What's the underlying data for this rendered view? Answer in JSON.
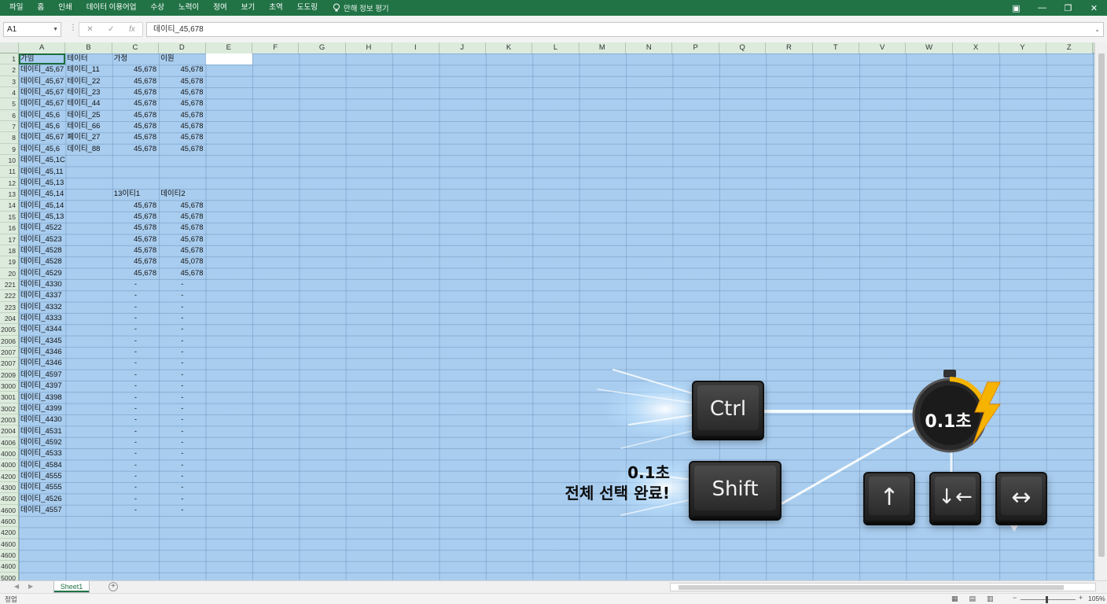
{
  "menu": {
    "items": [
      "파일",
      "홈",
      "인쇄",
      "데이터 이용어업",
      "수상",
      "노력이",
      "정여",
      "보기",
      "초역",
      "도도링"
    ],
    "tell_me": "만해 정보 평기"
  },
  "formula_bar": {
    "name_box": "A1",
    "formula": "데이티_45,678"
  },
  "columns": [
    "A",
    "B",
    "C",
    "D",
    "E",
    "F",
    "G",
    "H",
    "I",
    "J",
    "K",
    "L",
    "M",
    "N",
    "P",
    "Q",
    "R",
    "T",
    "V",
    "W",
    "X",
    "Y",
    "Z"
  ],
  "row_numbers": [
    "1",
    "2",
    "3",
    "4",
    "5",
    "6",
    "7",
    "8",
    "9",
    "10",
    "11",
    "12",
    "13",
    "14",
    "15",
    "16",
    "17",
    "18",
    "19",
    "20",
    "221",
    "222",
    "223",
    "204",
    "2005",
    "2006",
    "2007",
    "2007",
    "2009",
    "3000",
    "3001",
    "3002",
    "2003",
    "2004",
    "4006",
    "4000",
    "4000",
    "4200",
    "4300",
    "4500",
    "4600",
    "4600",
    "4200",
    "4600",
    "4600",
    "4600",
    "5000"
  ],
  "cells": {
    "header_row": {
      "A": "가임",
      "B": "테이터",
      "C": "가정",
      "D": "이원"
    },
    "colA": [
      "데이티_45,67",
      "데이티_45,67",
      "데이티_45,67",
      "데이티_45,67",
      "데이티_45,6",
      "데이티_45,6",
      "데이티_45,67",
      "데이티_45,6",
      "데이티_45,1C",
      "데이티_45,11",
      "데이티_45,13",
      "데이티_45,14",
      "데이티_45,14",
      "데이티_45,13",
      "데이티_4522",
      "데이티_4523",
      "데이티_4528",
      "데이티_4528",
      "데이티_4529",
      "데이티_4330",
      "데이티_4337",
      "데이티_4332",
      "데이티_4333",
      "데이티_4344",
      "데이티_4345",
      "데이티_4346",
      "데이티_4346",
      "데이티_4597",
      "데이티_4397",
      "데이티_4398",
      "데이티_4399",
      "데이티_4430",
      "데이티_4531",
      "데이티_4592",
      "데이티_4533",
      "데이티_4584",
      "데이티_4555",
      "데이티_4555",
      "데이티_4526",
      "데이티_4557"
    ],
    "colB": [
      "테이티_11",
      "테이티_22",
      "테이티_23",
      "테이티_44",
      "테이티_25",
      "테이티_66",
      "폐이티_27",
      "데이티_88"
    ],
    "colC_top": [
      "45,678",
      "45,678",
      "45,678",
      "45,678",
      "45,678",
      "45,678",
      "45,678",
      "45,678"
    ],
    "colD_top": [
      "45,678",
      "45,678",
      "45,678",
      "45,678",
      "45,678",
      "45,678",
      "45,678",
      "45,678"
    ],
    "row13": {
      "C": "13이티1",
      "D": "데이티2"
    },
    "colC_mid": [
      "45,678",
      "45,678",
      "45,678",
      "45,678",
      "45,678",
      "45,678",
      "45,678"
    ],
    "colD_mid": [
      "45,678",
      "45,678",
      "45,678",
      "45,678",
      "45,678",
      "45,078",
      "45,678"
    ],
    "dash": "-",
    "dash_rows": 21
  },
  "overlay": {
    "keys": {
      "ctrl": "Ctrl",
      "shift": "Shift",
      "up": "↑",
      "down_left": "↓←",
      "left_right": "↔"
    },
    "timer": "0.1초",
    "caption_line1": "0.1초",
    "caption_line2": "전체 선택 완료!"
  },
  "sheet": {
    "tab": "Sheet1",
    "add": "⊕"
  },
  "status": {
    "text": "정업",
    "zoom": "105%"
  }
}
